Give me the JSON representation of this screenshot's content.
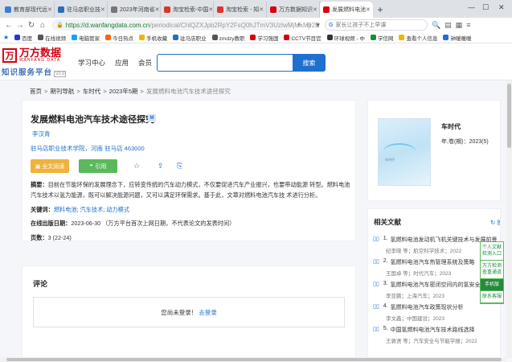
{
  "browser": {
    "tabs": [
      {
        "title": "教育部现代远",
        "color": "#3b7dd8"
      },
      {
        "title": "驻马店职业技",
        "color": "#2a6fb5"
      },
      {
        "title": "2023年河南省",
        "color": "#777"
      },
      {
        "title": "淘宝检索-中国",
        "color": "#e0332b"
      },
      {
        "title": "淘宝检索 - 知",
        "color": "#e0332b"
      },
      {
        "title": "万方数据知识",
        "color": "#d6000f"
      },
      {
        "title": "发展燃料电池",
        "color": "#d6000f"
      }
    ],
    "new_tab": "+",
    "url_host": "https://d.wanfangdata.com.cn",
    "url_path": "/periodical/ChlQZXJpb2RpY2FsQ0hJTmV3UzIwMjMxMjI2E",
    "search_placeholder": "家长让孩子不上早课",
    "bookmarks": [
      {
        "label": "百度",
        "color": "#2932e1"
      },
      {
        "label": "在线视频",
        "color": "#555"
      },
      {
        "label": "电脑管家",
        "color": "#1aa1ff"
      },
      {
        "label": "今日热点",
        "color": "#ff6600"
      },
      {
        "label": "手机收藏",
        "color": "#f4b400"
      },
      {
        "label": "驻马店职业",
        "color": "#2a6fb5"
      },
      {
        "label": "zmdzy教职",
        "color": "#555"
      },
      {
        "label": "学习强国",
        "color": "#d6000f"
      },
      {
        "label": "CCTV节目官",
        "color": "#d6000f"
      },
      {
        "label": "环球视频 - 中",
        "color": "#333"
      },
      {
        "label": "学信网",
        "color": "#1a8e3a"
      },
      {
        "label": "查看个人信息",
        "color": "#f4b400"
      },
      {
        "label": "钟暖暖暖",
        "color": "#1f6fce"
      }
    ]
  },
  "site": {
    "logo_mark": "万",
    "logo_cn": "万方数据",
    "logo_en": "WANFANG DATA",
    "logo_sub": "知识服务平台",
    "logo_ver": "V2.0",
    "nav": [
      "学习中心",
      "应用",
      "会员"
    ],
    "search_button": "搜索"
  },
  "breadcrumb": {
    "items": [
      "首页",
      "期刊导航",
      "车时代",
      "2023年5期"
    ],
    "current": "发展燃料电池汽车技术途径探究"
  },
  "article": {
    "title": "发展燃料电池汽车技术途径探究",
    "badge": "M",
    "author": "李汉青",
    "affiliation": "驻马店职业技术学院，河南 驻马店 463000",
    "fulltext_button": "全文阅读",
    "cite_button": "引用",
    "abstract_label": "摘要：",
    "abstract": "目前在节能环保的发展理念下，应转变传统的汽车动力模式，不仅要促进汽车产业振兴，也要带动能源 转型。燃料电池汽车技术以氢为能源，既可以解决能源问题，又可以满足环保需求。基于此，文章对燃料电池汽车技 术进行分析。",
    "keywords_label": "关键词：",
    "keywords": [
      "燃料电池",
      "汽车技术",
      "动力模式"
    ],
    "pubdate_label": "在线出版日期：",
    "pubdate": "2023-06-30",
    "pubdate_note": "（万方平台首次上网日期，不代表论文的发表时间）",
    "pages_label": "页数：",
    "pages": "3 (22-24)"
  },
  "comments": {
    "title": "评论",
    "login_prompt": "您尚未登录！",
    "login_link": "去登录"
  },
  "journal": {
    "name": "车时代",
    "issue": "年,卷(期)：2023(5)",
    "cover_text": "车时代"
  },
  "related": {
    "title": "相关文献",
    "refresh": "换",
    "items": [
      {
        "num": "1.",
        "title": "氢燃料电池发动机飞机关键技术与发展前景",
        "meta": "纪李晓  等；航空科学技术；2022"
      },
      {
        "num": "2.",
        "title": "氢燃料电池汽车热管理系统及策略",
        "meta": "王国卓  等；时代汽车；2023"
      },
      {
        "num": "3.",
        "title": "氢燃料电池汽车密闭空间内的氢安全",
        "meta": "李亚鹏；上海汽车；2023"
      },
      {
        "num": "4.",
        "title": "氢燃料电池汽车政策现状分析",
        "meta": "李文鑫；中国建设；2023"
      },
      {
        "num": "5.",
        "title": "中国氢燃料电池汽车技术路线选择",
        "meta": "王敦贤  等；汽车安全与节能学报；2022"
      }
    ]
  },
  "float_panel": [
    "个人文献检测入口",
    "万方检测查重通道",
    "手机版",
    "联系客服"
  ]
}
